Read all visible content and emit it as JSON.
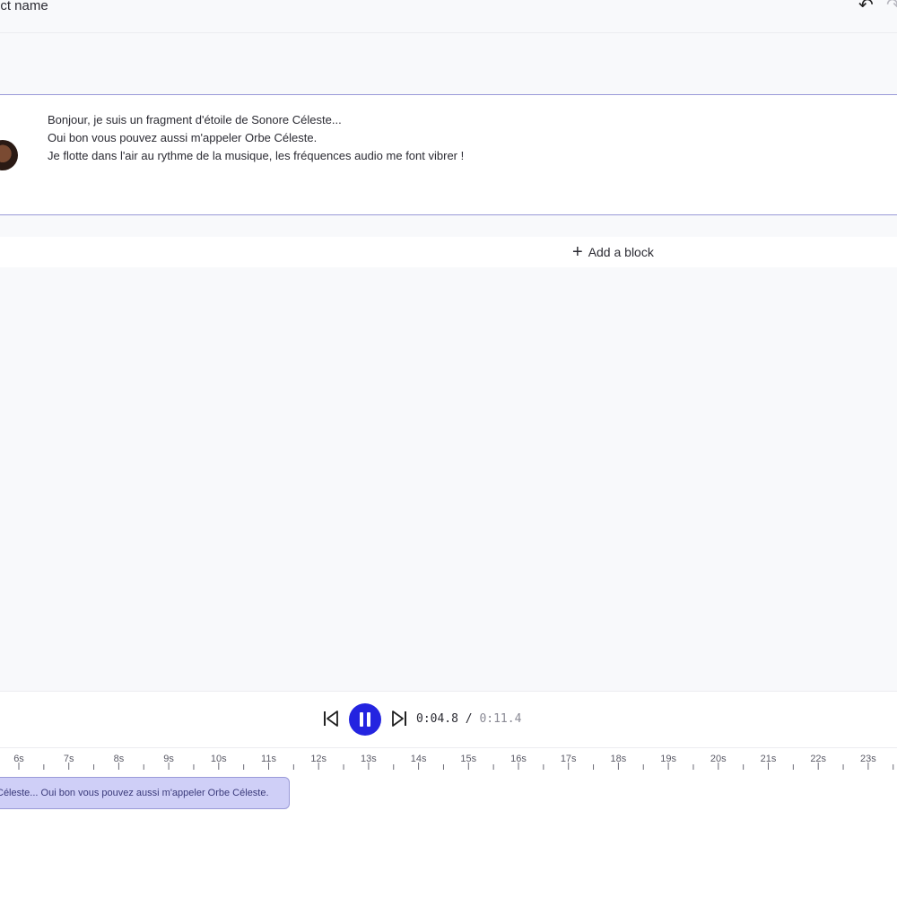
{
  "header": {
    "project_name": "ect name",
    "undo_icon": "undo-icon",
    "redo_icon": "redo-icon"
  },
  "block": {
    "avatar": "avatar",
    "lines": [
      "Bonjour, je suis un fragment d'étoile de Sonore Céleste...",
      "Oui bon vous pouvez aussi m'appeler Orbe Céleste.",
      "Je flotte dans l'air au rythme de la musique, les fréquences audio me font vibrer !"
    ]
  },
  "add_block": {
    "label": "Add a block",
    "icon": "plus-icon"
  },
  "player": {
    "current_time": "0:04.8",
    "separator": " / ",
    "total_time": "0:11.4",
    "accent": "#2424e0"
  },
  "timeline": {
    "ticks": [
      "6s",
      "7s",
      "8s",
      "9s",
      "10s",
      "11s",
      "12s",
      "13s",
      "14s",
      "15s",
      "16s",
      "17s",
      "18s",
      "19s",
      "20s",
      "21s",
      "22s",
      "23s"
    ],
    "clip_text": "Céleste... Oui bon vous pouvez aussi m'appeler Orbe Céleste.",
    "clip_color": "#cfcff7",
    "clip_border": "#9a9ad8"
  }
}
